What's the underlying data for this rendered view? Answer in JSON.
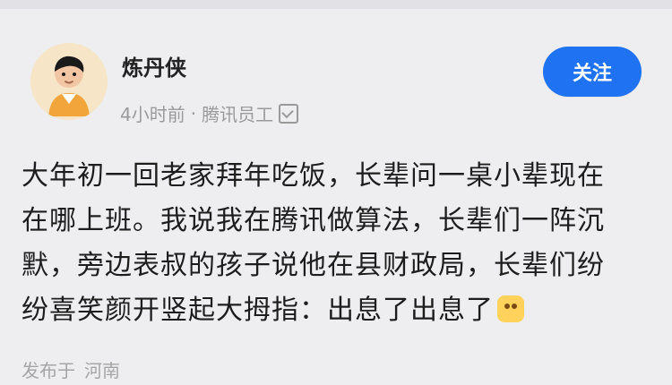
{
  "author": {
    "name": "炼丹侠",
    "time": "4小时前",
    "separator": "·",
    "title": "腾讯员工",
    "verified_icon": "verified-icon"
  },
  "actions": {
    "follow_label": "关注"
  },
  "post": {
    "lines": [
      "大年初一回老家拜年吃饭，长辈问一桌小辈现在",
      "在哪上班。我说我在腾讯做算法，长辈们一阵沉",
      "默，旁边表叔的孩子说他在县财政局，长辈们纷",
      "纷喜笑颜开竖起大拇指：出息了出息了"
    ],
    "emoji_icon": "laugh-emoji-icon"
  },
  "footer": {
    "location_prefix": "发布于",
    "location": "河南"
  },
  "colors": {
    "accent": "#1f73f2",
    "background": "#eeeef1",
    "text": "#1d1d1d",
    "meta": "#9a9a9a"
  }
}
